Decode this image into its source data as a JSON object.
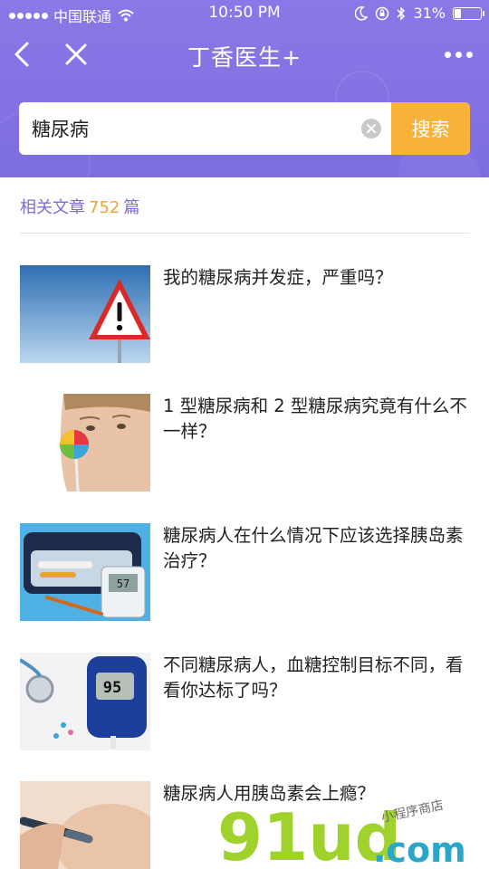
{
  "status_bar": {
    "carrier": "中国联通",
    "time": "10:50 PM",
    "battery": "31%",
    "battery_level": 0.31
  },
  "nav": {
    "title": "丁香医生+"
  },
  "search": {
    "value": "糖尿病",
    "button": "搜索"
  },
  "results": {
    "label": "相关文章",
    "count": "752",
    "unit": "篇"
  },
  "articles": [
    {
      "title": "我的糖尿病并发症，严重吗？",
      "thumb": "warning-sign-image"
    },
    {
      "title": "1 型糖尿病和 2 型糖尿病究竟有什么不一样？",
      "thumb": "child-lollipop-image"
    },
    {
      "title": "糖尿病人在什么情况下应该选择胰岛素治疗？",
      "thumb": "insulin-kit-image"
    },
    {
      "title": "不同糖尿病人，血糖控制目标不同，看看你达标了吗？",
      "thumb": "glucose-meter-image"
    },
    {
      "title": "糖尿病人用胰岛素会上瘾？",
      "thumb": "insulin-pen-image"
    }
  ],
  "glucose_reading": "95",
  "watermark": {
    "brand": "91ud",
    "domain": ".com",
    "tagline": "小程序商店"
  },
  "colors": {
    "header": "#8a78e6",
    "accent_orange": "#f6b23a",
    "count_purple": "#7a6fd0"
  }
}
